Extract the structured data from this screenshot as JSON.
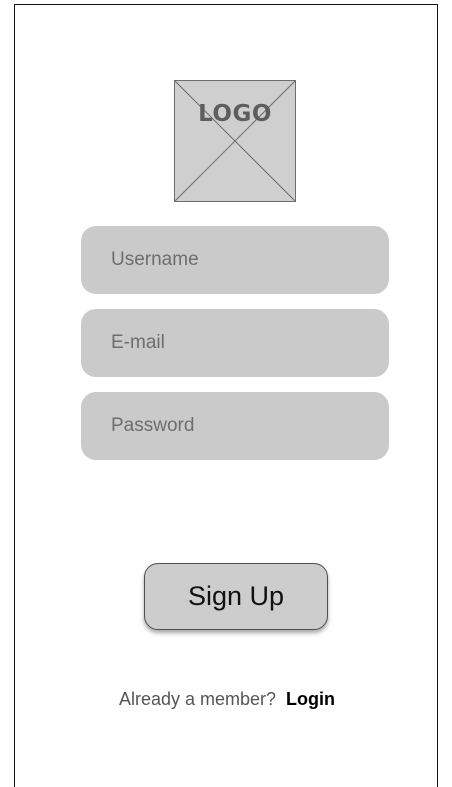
{
  "logo": {
    "text": "LOGO"
  },
  "form": {
    "username_placeholder": "Username",
    "email_placeholder": "E-mail",
    "password_placeholder": "Password",
    "signup_label": "Sign Up"
  },
  "footer": {
    "prompt": "Already a member?",
    "login_label": "Login"
  },
  "colors": {
    "field_background": "#cacaca",
    "button_background": "#cdcdcd",
    "logo_background": "#cfcfcf"
  }
}
